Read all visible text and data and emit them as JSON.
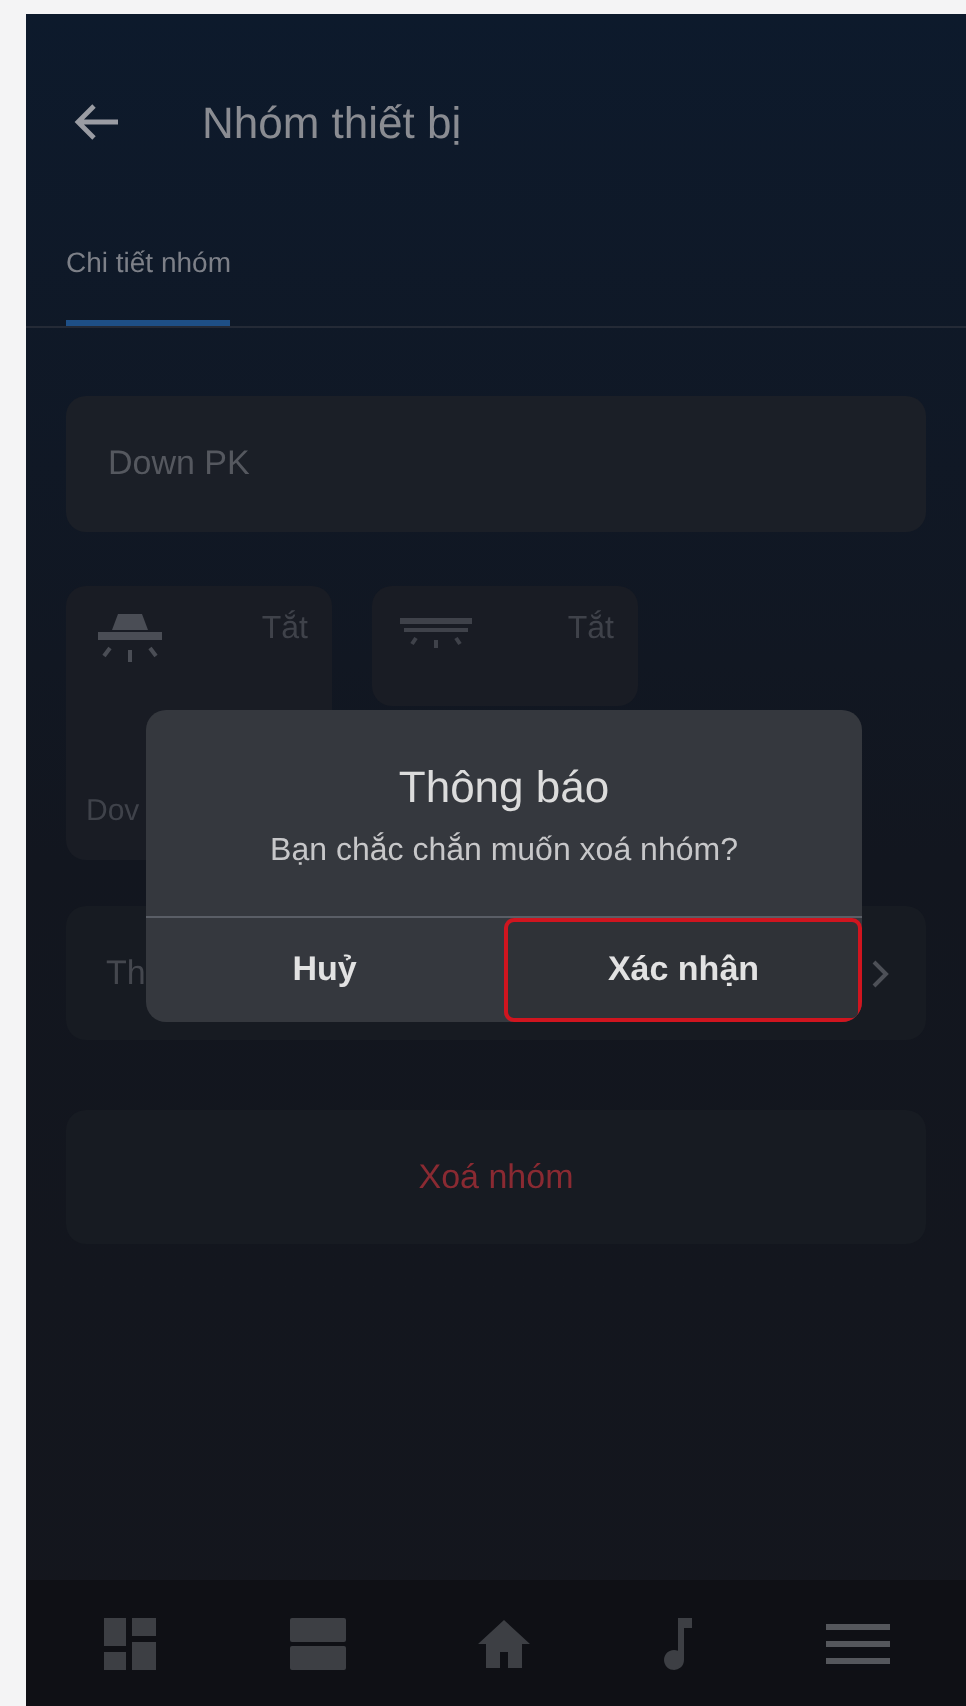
{
  "header": {
    "title": "Nhóm thiết bị"
  },
  "tabs": [
    {
      "label": "Chi tiết nhóm",
      "selected": true
    }
  ],
  "name_field": {
    "value": "Down PK"
  },
  "devices": [
    {
      "kind": "ceiling-lamp",
      "status": "Tắt",
      "name": "Dov"
    },
    {
      "kind": "linear-lamp",
      "status": "Tắt"
    }
  ],
  "row": {
    "label": "Th"
  },
  "delete_button": {
    "label": "Xoá nhóm"
  },
  "dialog": {
    "title": "Thông báo",
    "message": "Bạn chắc chắn muốn xoá nhóm?",
    "buttons": [
      {
        "label": "Huỷ",
        "selected": false
      },
      {
        "label": "Xác nhận",
        "selected": true
      }
    ]
  },
  "bottom_nav": [
    {
      "kind": "dashboard"
    },
    {
      "kind": "rows"
    },
    {
      "kind": "home"
    },
    {
      "kind": "music"
    },
    {
      "kind": "menu"
    }
  ]
}
